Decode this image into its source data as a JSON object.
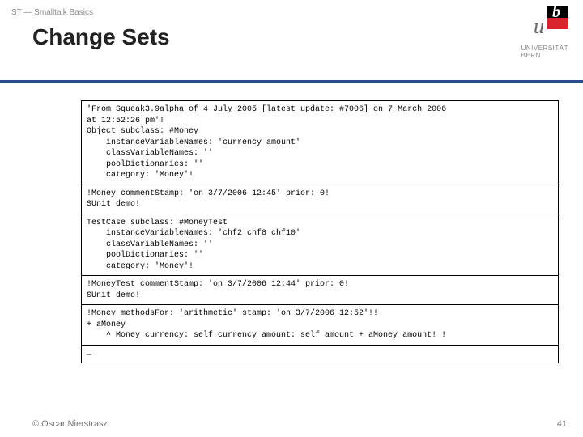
{
  "breadcrumb": "ST — Smalltalk Basics",
  "title": "Change Sets",
  "logo": {
    "u": "u",
    "b": "b",
    "line1": "UNIVERSITÄT",
    "line2": "BERN"
  },
  "code": {
    "section1": "'From Squeak3.9alpha of 4 July 2005 [latest update: #7006] on 7 March 2006\nat 12:52:26 pm'!\nObject subclass: #Money\n    instanceVariableNames: 'currency amount'\n    classVariableNames: ''\n    poolDictionaries: ''\n    category: 'Money'!",
    "section2": "!Money commentStamp: 'on 3/7/2006 12:45' prior: 0!\nSUnit demo!",
    "section3": "TestCase subclass: #MoneyTest\n    instanceVariableNames: 'chf2 chf8 chf10'\n    classVariableNames: ''\n    poolDictionaries: ''\n    category: 'Money'!",
    "section4": "!MoneyTest commentStamp: 'on 3/7/2006 12:44' prior: 0!\nSUnit demo!\n",
    "section5": "!Money methodsFor: 'arithmetic' stamp: 'on 3/7/2006 12:52'!!\n+ aMoney\n    ^ Money currency: self currency amount: self amount + aMoney amount! !",
    "section6": "…"
  },
  "footer": {
    "author": "© Oscar Nierstrasz",
    "page": "41"
  }
}
